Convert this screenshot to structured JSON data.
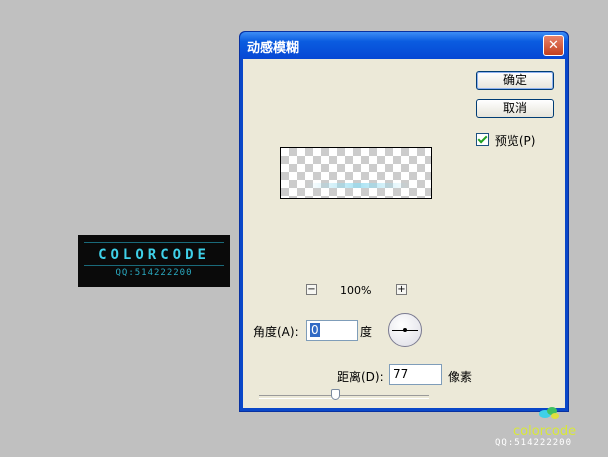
{
  "logo": {
    "main": "COLORCODE",
    "sub": "QQ:514222200"
  },
  "dialog": {
    "title": "动感模糊",
    "close_label": "✕",
    "ok_label": "确定",
    "cancel_label": "取消",
    "preview_label": "预览(P)",
    "preview_checked": true,
    "zoom_minus": "−",
    "zoom_plus": "+",
    "zoom_level": "100%",
    "angle_label": "角度(A):",
    "angle_value": "0",
    "angle_unit": "度",
    "distance_label": "距离(D):",
    "distance_value": "77",
    "distance_unit": "像素",
    "distance_slider_fraction": 0.45
  },
  "watermark": {
    "main": "colorcode",
    "sub": "QQ:514222200"
  },
  "colors": {
    "desktop": "#c0c0c0",
    "title_bar": "#0a5ce0",
    "dialog_bg": "#ece9d8",
    "logo_text": "#3fd0e8"
  }
}
